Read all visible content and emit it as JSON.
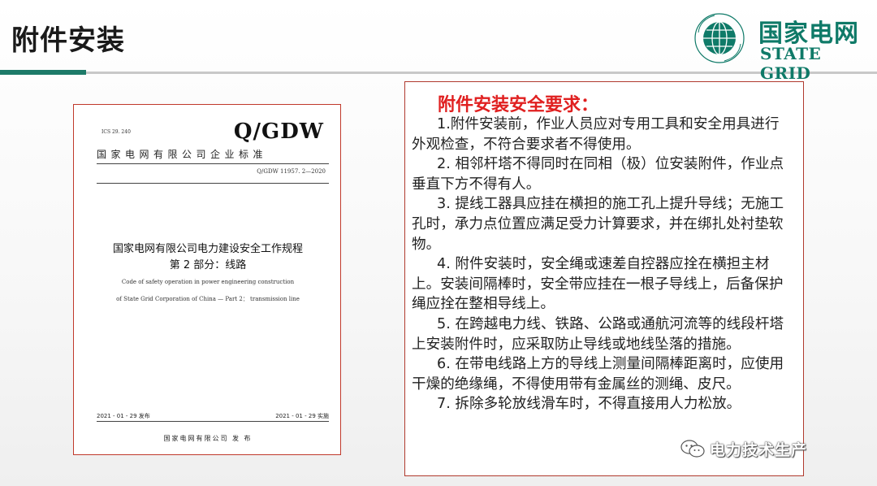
{
  "slide": {
    "title": "附件安装"
  },
  "logo": {
    "cn": "国家电网",
    "en": "STATE GRID",
    "accent": "#0f7a68"
  },
  "document_cover": {
    "ics": "ICS 29. 240",
    "category_code": "",
    "brand": "Q/GDW",
    "org": "国家电网有限公司企业标准",
    "number": "Q/GDW 11957. 2—2020",
    "title_main": "国家电网有限公司电力建设安全工作规程",
    "title_sub": "第 2 部分：线路",
    "en_line_1": "Code of safety operation in power engineering construction",
    "en_line_2": "of State Grid Corporation of China — Part 2： transmission line",
    "issue_date": "2021 - 01 - 29 发布",
    "implement_date": "2021 - 01 - 29 实施",
    "publisher": "国家电网有限公司    发 布"
  },
  "requirements": {
    "heading": "附件安装安全要求：",
    "items": [
      "1.附件安装前，作业人员应对专用工具和安全用具进行外观检查，不符合要求者不得使用。",
      "2. 相邻杆塔不得同时在同相（极）位安装附件，作业点垂直下方不得有人。",
      "3. 提线工器具应挂在横担的施工孔上提升导线；无施工孔时，承力点位置应满足受力计算要求，并在绑扎处衬垫软物。",
      "4. 附件安装时，安全绳或速差自控器应拴在横担主材上。安装间隔棒时，安全带应挂在一根子导线上，后备保护绳应拴在整相导线上。",
      "5. 在跨越电力线、铁路、公路或通航河流等的线段杆塔上安装附件时，应采取防止导线或地线坠落的措施。",
      "6. 在带电线路上方的导线上测量间隔棒距离时，应使用干燥的绝缘绳，不得使用带有金属丝的测绳、皮尺。",
      "7. 拆除多轮放线滑车时，不得直接用人力松放。"
    ],
    "heading_color": "#e02020"
  },
  "watermark": {
    "text": "电力技术生产",
    "icon": "wechat-icon"
  }
}
